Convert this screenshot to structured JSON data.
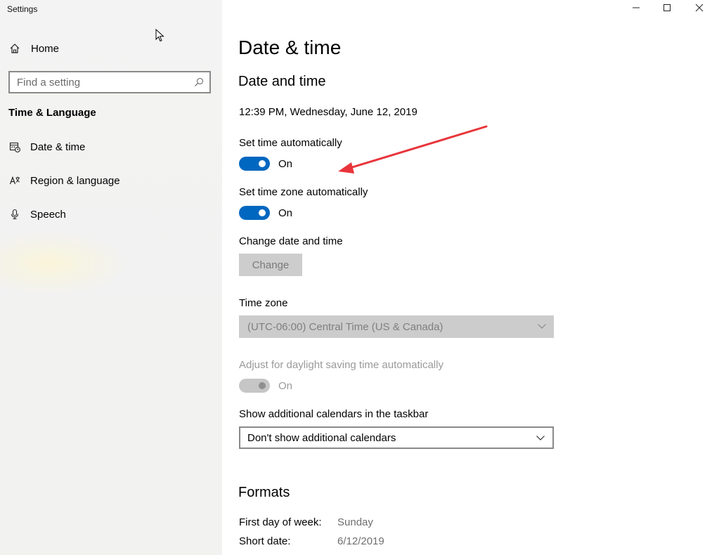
{
  "window": {
    "title": "Settings",
    "controls": {
      "minimize": "minimize",
      "maximize": "maximize",
      "close": "close"
    }
  },
  "sidebar": {
    "home_label": "Home",
    "search": {
      "placeholder": "Find a setting"
    },
    "section_title": "Time & Language",
    "items": [
      {
        "label": "Date & time",
        "icon": "calendar-clock-icon"
      },
      {
        "label": "Region & language",
        "icon": "language-icon"
      },
      {
        "label": "Speech",
        "icon": "microphone-icon"
      }
    ]
  },
  "main": {
    "title": "Date & time",
    "subtitle": "Date and time",
    "current_datetime": "12:39 PM, Wednesday, June 12, 2019",
    "set_time_auto": {
      "label": "Set time automatically",
      "state": "On",
      "enabled": true
    },
    "set_timezone_auto": {
      "label": "Set time zone automatically",
      "state": "On",
      "enabled": true
    },
    "change_date_time": {
      "label": "Change date and time",
      "button": "Change"
    },
    "time_zone": {
      "label": "Time zone",
      "value": "(UTC-06:00) Central Time (US & Canada)"
    },
    "daylight_saving": {
      "label": "Adjust for daylight saving time automatically",
      "state": "On",
      "enabled": false
    },
    "additional_calendars": {
      "label": "Show additional calendars in the taskbar",
      "value": "Don't show additional calendars"
    },
    "formats": {
      "title": "Formats",
      "rows": [
        {
          "key": "First day of week:",
          "value": "Sunday"
        },
        {
          "key": "Short date:",
          "value": "6/12/2019"
        }
      ]
    }
  },
  "colors": {
    "accent": "#0067c0",
    "annotation_arrow": "#e8353b"
  }
}
